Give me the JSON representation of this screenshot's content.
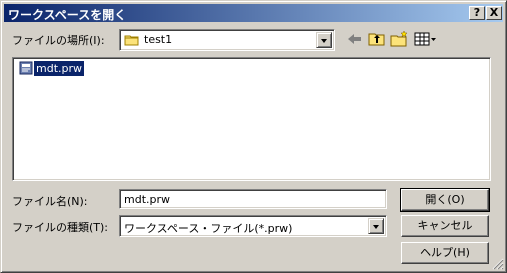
{
  "window": {
    "title": "ワークスペースを開く",
    "help_button": "?",
    "close_button": "X"
  },
  "location": {
    "label": "ファイルの場所(I):",
    "value": "test1",
    "folder_icon": "folder-icon"
  },
  "toolbar": {
    "icons": [
      "back-arrow-icon",
      "up-one-level-icon",
      "new-folder-icon",
      "view-menu-icon"
    ]
  },
  "file_list": {
    "items": [
      {
        "name": "mdt.prw",
        "icon": "workspace-file-icon",
        "selected": true
      }
    ]
  },
  "filename": {
    "label": "ファイル名(N):",
    "value": "mdt.prw"
  },
  "filetype": {
    "label": "ファイルの種類(T):",
    "value": "ワークスペース・ファイル(*.prw)"
  },
  "buttons": {
    "open": "開く(O)",
    "cancel": "キャンセル",
    "help": "ヘルプ(H)"
  },
  "colors": {
    "title_start": "#0a246a",
    "title_end": "#a6caf0",
    "selection": "#0a246a",
    "face": "#d4d0c8"
  }
}
